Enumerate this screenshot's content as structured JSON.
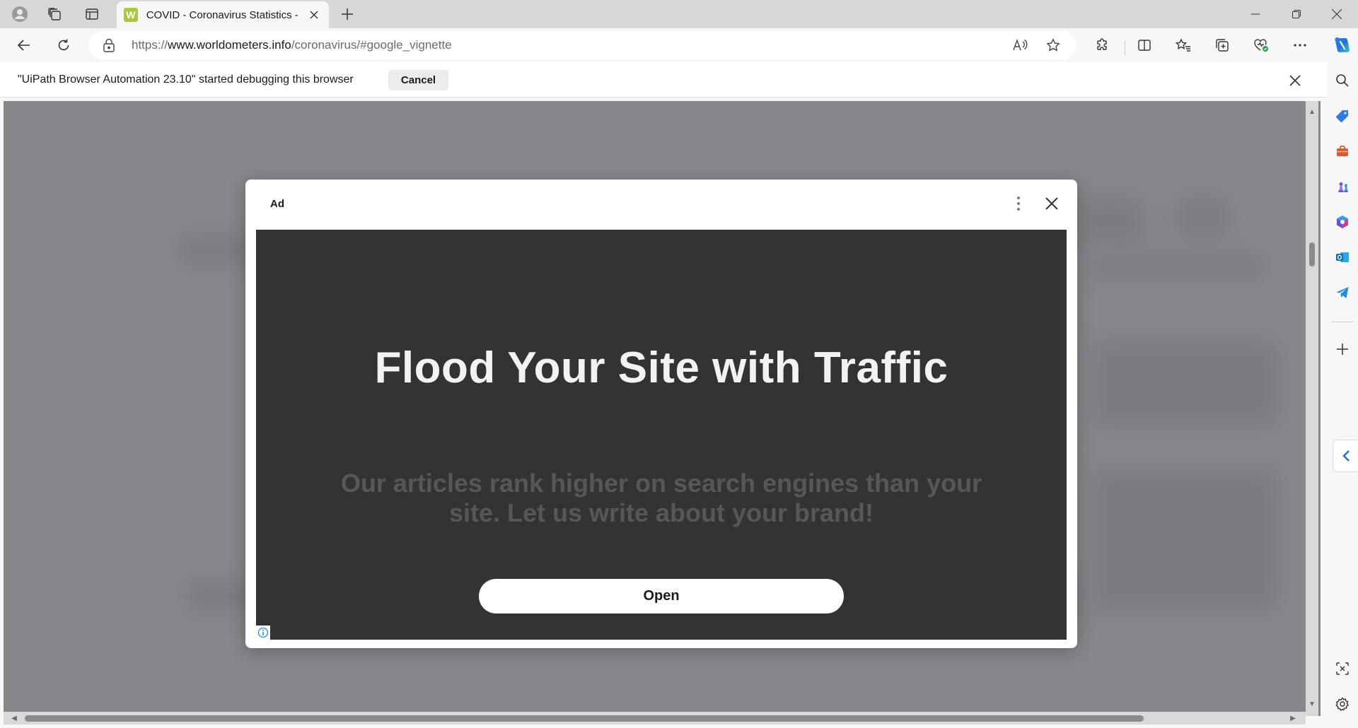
{
  "tab": {
    "title": "COVID - Coronavirus Statistics - Worldometer",
    "favicon": "W"
  },
  "urlbar": {
    "prefix": "https://",
    "host": "www.worldometers.info",
    "path": "/coronavirus/#google_vignette"
  },
  "infobar": {
    "message": "\"UiPath Browser Automation 23.10\" started debugging this browser",
    "cancel_label": "Cancel"
  },
  "ad": {
    "label": "Ad",
    "headline": "Flood Your Site with Traffic",
    "subtext": "Our articles rank higher on search engines than your site. Let us write about your brand!",
    "button_label": "Open"
  },
  "colors": {
    "accent": "#0f6cbd",
    "ad_background": "#333333",
    "overlay": "#85878b"
  }
}
